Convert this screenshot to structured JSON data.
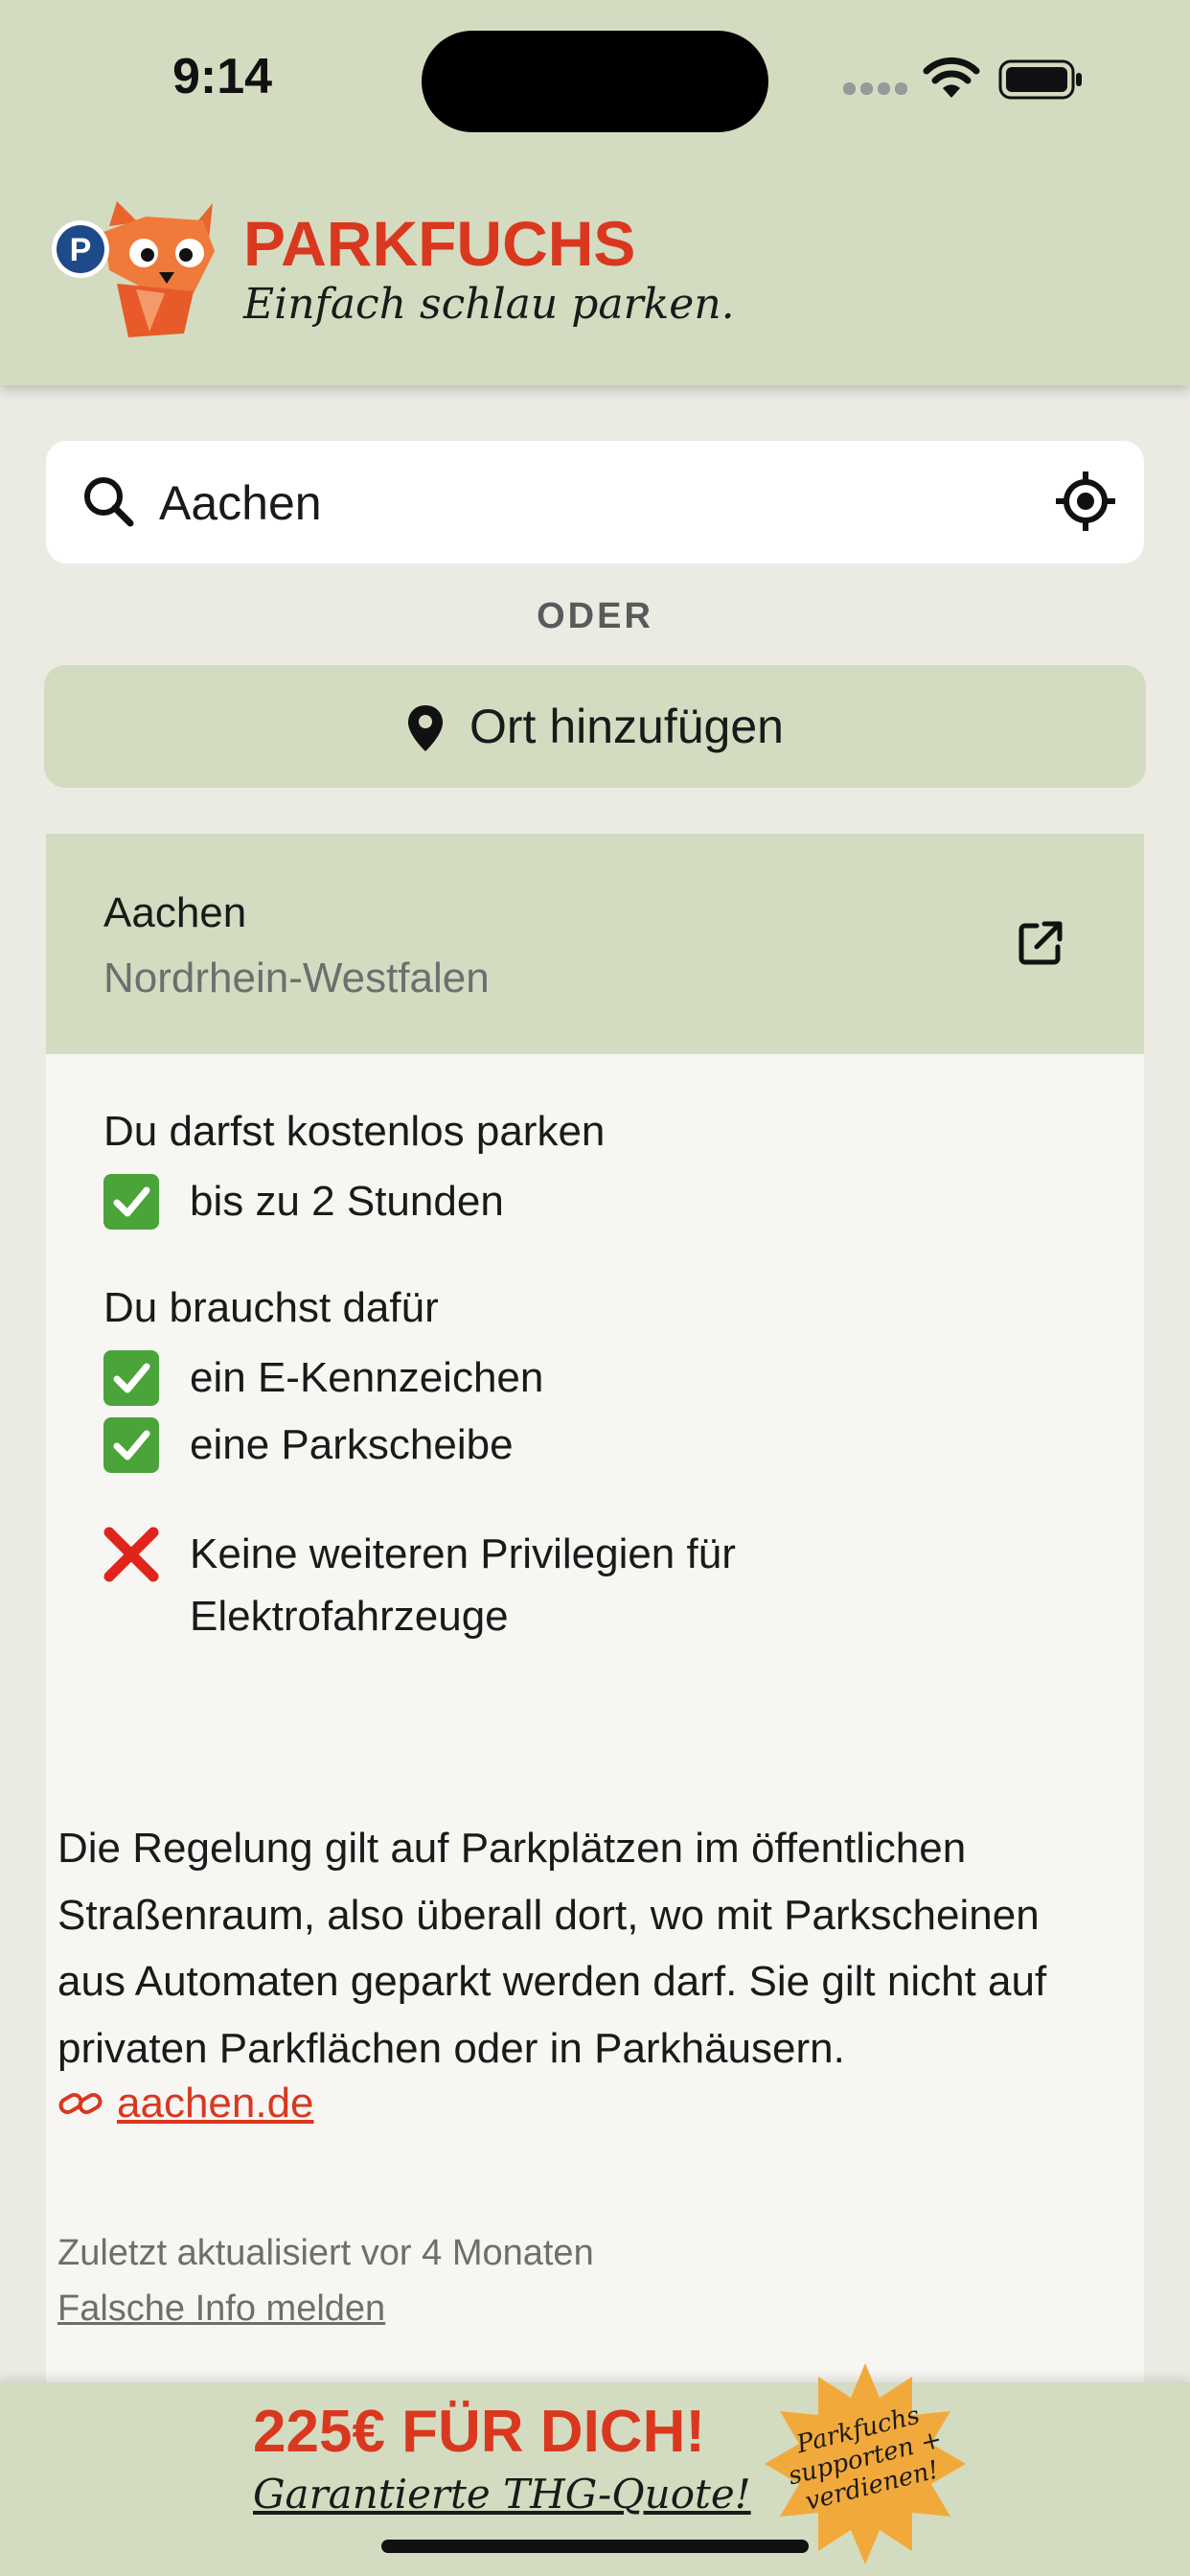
{
  "status_bar": {
    "time": "9:14"
  },
  "header": {
    "app_name": "PARKFUCHS",
    "slogan": "Einfach schlau parken."
  },
  "search": {
    "value": "Aachen"
  },
  "divider_label": "ODER",
  "add_place": {
    "label": "Ort hinzufügen"
  },
  "location_card": {
    "city": "Aachen",
    "state": "Nordrhein-Westfalen",
    "free_parking_title": "Du darfst kostenlos parken",
    "free_parking_items": [
      "bis zu 2 Stunden"
    ],
    "requirements_title": "Du brauchst dafür",
    "requirements_items": [
      "ein E-Kennzeichen",
      "eine Parkscheibe"
    ],
    "no_privileges_line1": "Keine weiteren Privilegien für",
    "no_privileges_line2": "Elektrofahrzeuge",
    "description": "Die Regelung gilt auf Parkplätzen im öffentlichen Straßenraum, also überall dort, wo mit Parkscheinen aus Automaten geparkt werden darf. Sie gilt nicht auf privaten Parkflächen oder in Parkhäusern.",
    "source_link": "aachen.de",
    "last_updated": "Zuletzt aktualisiert vor 4 Monaten",
    "report_label": "Falsche Info melden"
  },
  "promo_banner": {
    "title": "225€ FÜR DICH!",
    "subtitle": "Garantierte THG-Quote!",
    "badge_line1": "Parkfuchs",
    "badge_line2": "supporten +",
    "badge_line3": "verdienen!"
  },
  "colors": {
    "accent": "#d9381f",
    "header_bg": "#d3dcc0",
    "page_bg": "#ecebe3",
    "check_green": "#4aa43a"
  }
}
